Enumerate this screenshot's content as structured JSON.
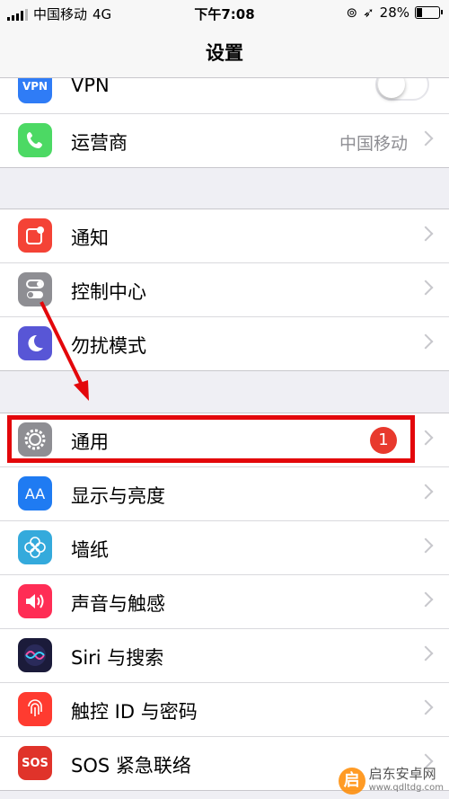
{
  "status_bar": {
    "carrier": "中国移动",
    "network": "4G",
    "time": "下午7:08",
    "battery": "28%",
    "battery_level": 0.28
  },
  "nav": {
    "title": "设置"
  },
  "group1": [
    {
      "label": "VPN",
      "icon": "vpn-icon",
      "color": "#2f7cf6",
      "icon_text": "VPN",
      "control": "toggle-off"
    },
    {
      "label": "运营商",
      "icon": "phone-icon",
      "color": "#4cd964",
      "detail": "中国移动"
    }
  ],
  "group2": [
    {
      "label": "通知",
      "icon": "notification-icon",
      "color": "#f44336"
    },
    {
      "label": "控制中心",
      "icon": "switches-icon",
      "color": "#8e8e93"
    },
    {
      "label": "勿扰模式",
      "icon": "moon-icon",
      "color": "#5856d6"
    }
  ],
  "group3": [
    {
      "label": "通用",
      "icon": "gear-icon",
      "color": "#8e8e93",
      "badge": "1"
    },
    {
      "label": "显示与亮度",
      "icon": "text-size-icon",
      "color": "#1f7bf2",
      "icon_text": "AA"
    },
    {
      "label": "墙纸",
      "icon": "flower-icon",
      "color": "#34aadc"
    },
    {
      "label": "声音与触感",
      "icon": "speaker-icon",
      "color": "#ff2d55"
    },
    {
      "label": "Siri 与搜索",
      "icon": "siri-icon",
      "color": "#1b1b3a"
    },
    {
      "label": "触控 ID 与密码",
      "icon": "fingerprint-icon",
      "color": "#ff3b30"
    },
    {
      "label": "SOS 紧急联络",
      "icon": "sos-icon",
      "color": "#e0332a",
      "icon_text": "SOS"
    }
  ],
  "watermark": {
    "logo_text": "启",
    "name": "启东安卓网",
    "url": "www.qdltdg.com"
  },
  "colors": {
    "highlight": "#e3070b",
    "background": "#efeff4"
  }
}
